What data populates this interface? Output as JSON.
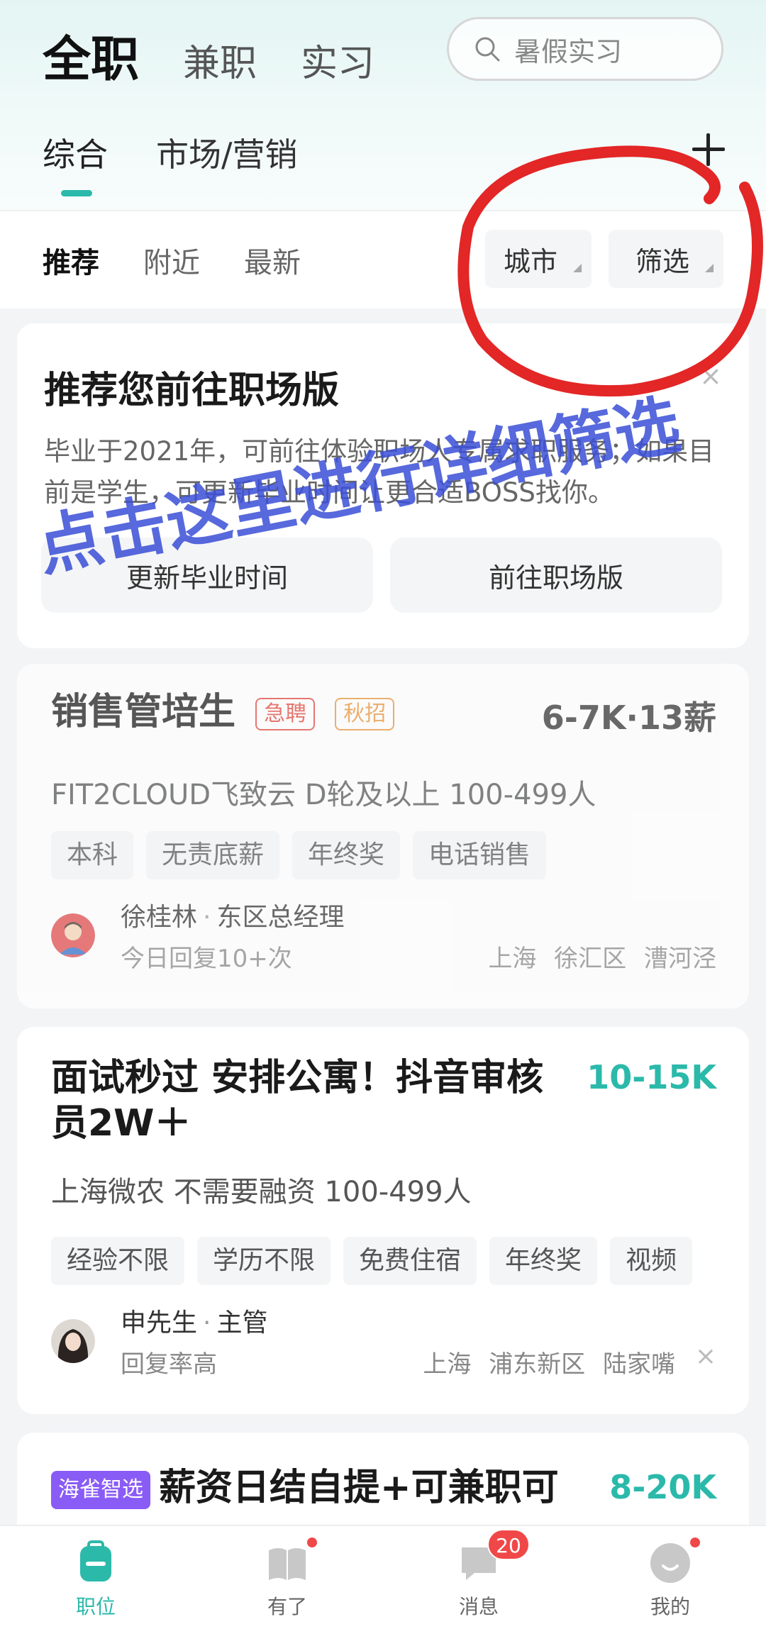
{
  "top_tabs": [
    "全职",
    "兼职",
    "实习"
  ],
  "search": {
    "placeholder": "暑假实习"
  },
  "categories": [
    "综合",
    "市场/营销"
  ],
  "sub_tabs": [
    "推荐",
    "附近",
    "最新"
  ],
  "filters": {
    "city": "城市",
    "filter": "筛选"
  },
  "promo": {
    "title": "推荐您前往职场版",
    "desc": "毕业于2021年，可前往体验职场人专属求职服务；如果目前是学生，可更新毕业时间让更合适BOSS找你。",
    "btn_update": "更新毕业时间",
    "btn_go": "前往职场版",
    "close": "×"
  },
  "jobs": [
    {
      "title": "销售管培生",
      "badges": [
        "急聘",
        "秋招"
      ],
      "salary": "6-7K·13薪",
      "company": "FIT2CLOUD飞致云  D轮及以上  100-499人",
      "tags": [
        "本科",
        "无责底薪",
        "年终奖",
        "电话销售"
      ],
      "recruiter_name": "徐桂林",
      "recruiter_title": "东区总经理",
      "reply": "今日回复10+次",
      "location": "上海 徐汇区 漕河泾"
    },
    {
      "title_line1": "面试秒过 安排公寓！抖音审核",
      "title_line2": "员2W＋",
      "salary": "10-15K",
      "company": "上海微农  不需要融资  100-499人",
      "tags": [
        "经验不限",
        "学历不限",
        "免费住宿",
        "年终奖",
        "视频"
      ],
      "recruiter_name": "申先生",
      "recruiter_title": "主管",
      "reply": "回复率高",
      "location": "上海 浦东新区 陆家嘴",
      "dismiss": "×"
    },
    {
      "ai_badge": "海雀智选",
      "title": "薪资日结自提+可兼职可",
      "salary": "8-20K"
    }
  ],
  "annotation": "点击这里进行详细筛选",
  "bottom_nav": [
    {
      "label": "职位",
      "icon": "briefcase-icon"
    },
    {
      "label": "有了",
      "icon": "book-icon"
    },
    {
      "label": "消息",
      "icon": "chat-icon",
      "badge": "20"
    },
    {
      "label": "我的",
      "icon": "profile-icon"
    }
  ],
  "colors": {
    "accent": "#2bb9aa",
    "red": "#f04848",
    "annotation": "#3a4fd6",
    "ai_badge": "#8a5cf6"
  }
}
